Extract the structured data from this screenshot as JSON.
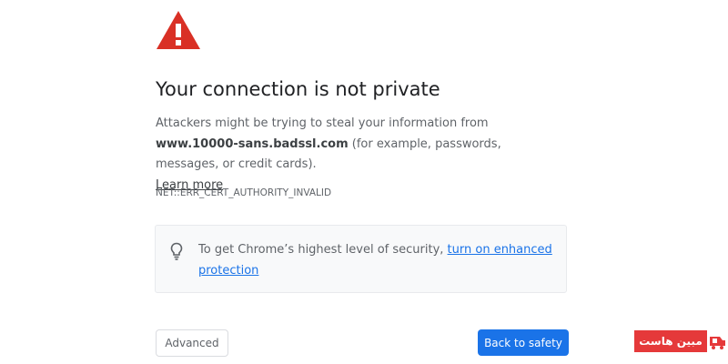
{
  "interstitial": {
    "title": "Your connection is not private",
    "message_prefix": "Attackers might be trying to steal your information from ",
    "domain": "www.10000-sans.badssl.com",
    "message_suffix": " (for example, passwords, messages, or credit cards).",
    "learn_more": "Learn more",
    "error_code": "NET::ERR_CERT_AUTHORITY_INVALID",
    "icon": "warning-triangle-icon",
    "icon_color": "#d93025"
  },
  "enhanced_protection": {
    "text_prefix": "To get Chrome’s highest level of security, ",
    "link": "turn on enhanced protection",
    "icon": "lightbulb-icon",
    "link_color": "#1a73e8"
  },
  "buttons": {
    "advanced": "Advanced",
    "back_to_safety": "Back to safety",
    "primary_color": "#1a73e8"
  },
  "watermark": {
    "text": "مبین هاست",
    "logo": "mihan-host-logo",
    "color": "#e5393a"
  }
}
